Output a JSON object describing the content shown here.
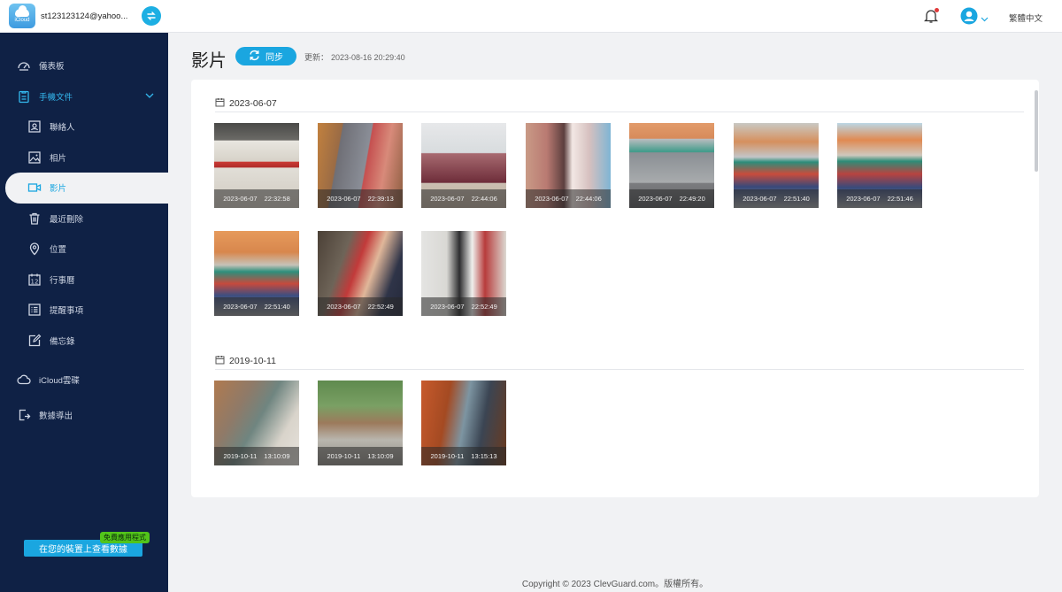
{
  "account": {
    "logo_text": "iCloud",
    "email": "st123123124@yahoo..."
  },
  "nav": {
    "dashboard": "儀表板",
    "phone_files": "手機文件",
    "contacts": "聯絡人",
    "photos": "相片",
    "videos": "影片",
    "recently_deleted": "最近刪除",
    "location": "位置",
    "calendar": "行事曆",
    "reminders": "提醒事項",
    "notes": "備忘錄",
    "icloud_drive": "iCloud雲碟",
    "export": "數據導出"
  },
  "promo": {
    "label": "在您的裝置上查看數據",
    "badge": "免費應用程式"
  },
  "topbar": {
    "language": "繁體中文"
  },
  "page": {
    "title": "影片",
    "sync_label": "同步",
    "update_label": "更新：",
    "update_time": "2023-08-16 20:29:40"
  },
  "groups": [
    {
      "date": "2023-06-07",
      "items": [
        {
          "date": "2023-06-07",
          "time": "22:32:58"
        },
        {
          "date": "2023-06-07",
          "time": "22:39:13"
        },
        {
          "date": "2023-06-07",
          "time": "22:44:06"
        },
        {
          "date": "2023-06-07",
          "time": "22:44:06"
        },
        {
          "date": "2023-06-07",
          "time": "22:49:20"
        },
        {
          "date": "2023-06-07",
          "time": "22:51:40"
        },
        {
          "date": "2023-06-07",
          "time": "22:51:46"
        },
        {
          "date": "2023-06-07",
          "time": "22:51:40"
        },
        {
          "date": "2023-06-07",
          "time": "22:52:49"
        },
        {
          "date": "2023-06-07",
          "time": "22:52:49"
        }
      ]
    },
    {
      "date": "2019-10-11",
      "items": [
        {
          "date": "2019-10-11",
          "time": "13:10:09"
        },
        {
          "date": "2019-10-11",
          "time": "13:10:09"
        },
        {
          "date": "2019-10-11",
          "time": "13:15:13"
        }
      ]
    }
  ],
  "footer": "Copyright © 2023 ClevGuard.com。版權所有。",
  "colors": {
    "sidebar": "#0f2145",
    "accent": "#1aa6e0",
    "badge": "#52c41a"
  }
}
